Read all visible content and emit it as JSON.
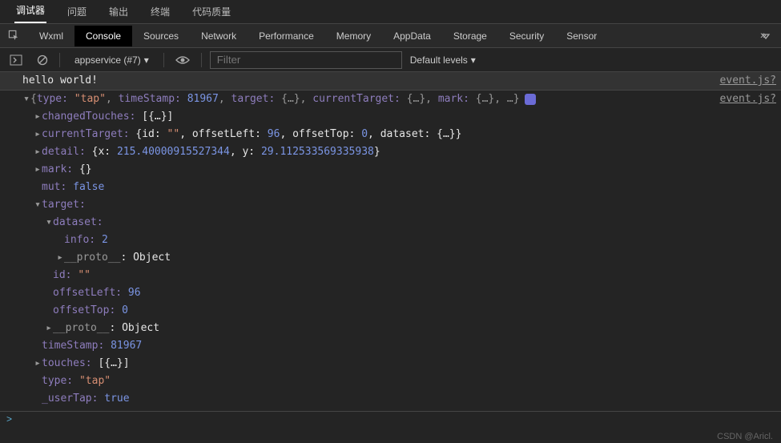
{
  "top_tabs": {
    "debugger": "调试器",
    "problems": "问题",
    "output": "输出",
    "terminal": "终端",
    "quality": "代码质量"
  },
  "panel_tabs": {
    "wxml": "Wxml",
    "console": "Console",
    "sources": "Sources",
    "network": "Network",
    "performance": "Performance",
    "memory": "Memory",
    "appdata": "AppData",
    "storage": "Storage",
    "security": "Security",
    "sensor": "Sensor"
  },
  "toolbar": {
    "context": "appservice (#7)",
    "filter_placeholder": "Filter",
    "levels": "Default levels"
  },
  "log": {
    "hello": "hello world!",
    "source": "event.js?",
    "summary": {
      "type_k": "type:",
      "type_v": "\"tap\"",
      "ts_k": "timeStamp:",
      "ts_v": "81967",
      "tgt_k": "target:",
      "tgt_v": "{…}",
      "ctgt_k": "currentTarget:",
      "ctgt_v": "{…}",
      "mark_k": "mark:",
      "mark_v": "{…}",
      "rest": "…"
    },
    "changedTouches": {
      "k": "changedTouches:",
      "v": "[{…}]"
    },
    "currentTarget": {
      "k": "currentTarget:",
      "id_k": "id:",
      "id_v": "\"\"",
      "ol_k": "offsetLeft:",
      "ol_v": "96",
      "ot_k": "offsetTop:",
      "ot_v": "0",
      "ds_k": "dataset:",
      "ds_v": "{…}"
    },
    "detail": {
      "k": "detail:",
      "x_k": "x:",
      "x_v": "215.40000915527344",
      "y_k": "y:",
      "y_v": "29.112533569335938"
    },
    "mark": {
      "k": "mark:",
      "v": "{}"
    },
    "mut": {
      "k": "mut:",
      "v": "false"
    },
    "target": {
      "k": "target:"
    },
    "dataset": {
      "k": "dataset:"
    },
    "info": {
      "k": "info:",
      "v": "2"
    },
    "proto": {
      "k": "__proto__",
      "v": "Object"
    },
    "id": {
      "k": "id:",
      "v": "\"\""
    },
    "offsetLeft": {
      "k": "offsetLeft:",
      "v": "96"
    },
    "offsetTop": {
      "k": "offsetTop:",
      "v": "0"
    },
    "timeStamp": {
      "k": "timeStamp:",
      "v": "81967"
    },
    "touches": {
      "k": "touches:",
      "v": "[{…}]"
    },
    "type": {
      "k": "type:",
      "v": "\"tap\""
    },
    "userTap": {
      "k": "_userTap:",
      "v": "true"
    }
  },
  "prompt": ">",
  "watermark": "CSDN @Aricl."
}
